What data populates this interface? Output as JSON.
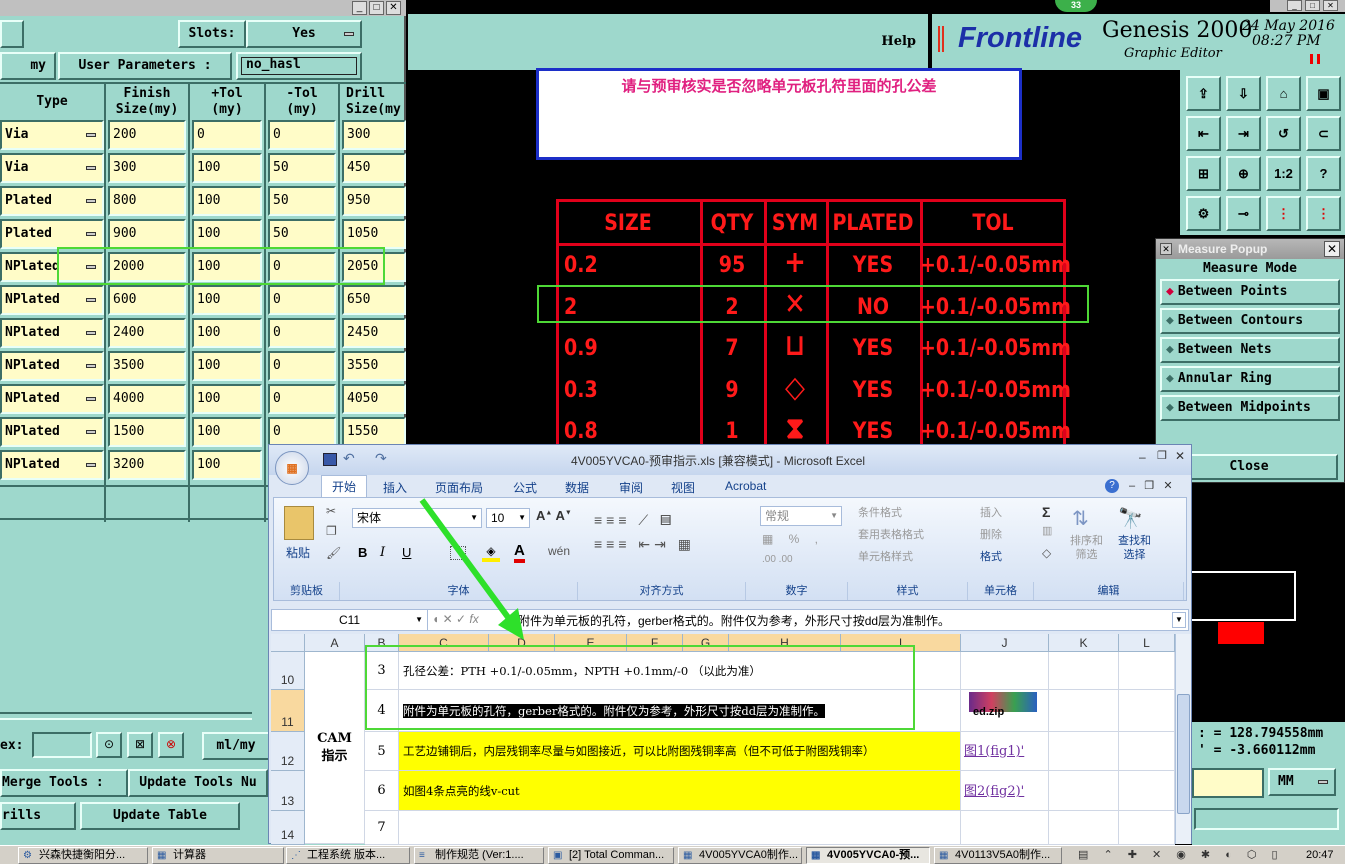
{
  "left_panel": {
    "slots_label": "Slots:",
    "slots_value": "Yes",
    "unit_label": "my",
    "user_params_label": "User Parameters :",
    "user_params_value": "no_hasl",
    "headers": [
      "Type",
      "Finish\nSize(my)",
      "+Tol\n(my)",
      "-Tol\n(my)",
      "Drill\nSize(my"
    ],
    "rows": [
      {
        "type": "Via",
        "finish": "200",
        "ptol": "0",
        "mtol": "0",
        "drill": "300"
      },
      {
        "type": "Via",
        "finish": "300",
        "ptol": "100",
        "mtol": "50",
        "drill": "450"
      },
      {
        "type": "Plated",
        "finish": "800",
        "ptol": "100",
        "mtol": "50",
        "drill": "950"
      },
      {
        "type": "Plated",
        "finish": "900",
        "ptol": "100",
        "mtol": "50",
        "drill": "1050"
      },
      {
        "type": "NPlated",
        "finish": "2000",
        "ptol": "100",
        "mtol": "0",
        "drill": "2050"
      },
      {
        "type": "NPlated",
        "finish": "600",
        "ptol": "100",
        "mtol": "0",
        "drill": "650"
      },
      {
        "type": "NPlated",
        "finish": "2400",
        "ptol": "100",
        "mtol": "0",
        "drill": "2450"
      },
      {
        "type": "NPlated",
        "finish": "3500",
        "ptol": "100",
        "mtol": "0",
        "drill": "3550"
      },
      {
        "type": "NPlated",
        "finish": "4000",
        "ptol": "100",
        "mtol": "0",
        "drill": "4050"
      },
      {
        "type": "NPlated",
        "finish": "1500",
        "ptol": "100",
        "mtol": "0",
        "drill": "1550"
      },
      {
        "type": "NPlated",
        "finish": "3200",
        "ptol": "100",
        "mtol": "",
        "drill": ""
      }
    ],
    "ex_label": "ex:",
    "units_btn": "ml/my",
    "merge_tools": "Merge Tools :",
    "update_tools": "Update Tools Nu",
    "drills": "rills",
    "update_table": "Update Table"
  },
  "genesis": {
    "help": "Help",
    "brand": "Frontline",
    "product": "Genesis 2000",
    "subtitle": "Graphic Editor",
    "date": "24 May 2016",
    "time": "08:27 PM",
    "badge": "33",
    "tool_icons": [
      "upload-icon",
      "download-icon",
      "home-icon",
      "window-icon",
      "move-left-icon",
      "move-right-icon",
      "undo-icon",
      "redo-icon",
      "fit-icon",
      "pan-icon",
      "scale-icon",
      "help-icon",
      "settings-icon",
      "measure-icon",
      "layer-icon",
      "layer-red-icon"
    ],
    "scale_text": "1:2",
    "note_text": "请与预审核实是否忽略单元板孔符里面的孔公差",
    "drill_table": {
      "headers": [
        "SIZE",
        "QTY",
        "SYM",
        "PLATED",
        "TOL"
      ],
      "rows": [
        {
          "size": "0.2",
          "qty": "95",
          "sym": "+",
          "plated": "YES",
          "tol": "+0.1/-0.05mm"
        },
        {
          "size": "2",
          "qty": "2",
          "sym": "✕",
          "plated": "NO",
          "tol": "+0.1/-0.05mm"
        },
        {
          "size": "0.9",
          "qty": "7",
          "sym": "⊔",
          "plated": "YES",
          "tol": "+0.1/-0.05mm"
        },
        {
          "size": "0.3",
          "qty": "9",
          "sym": "◇",
          "plated": "YES",
          "tol": "+0.1/-0.05mm"
        },
        {
          "size": "0.8",
          "qty": "1",
          "sym": "⧗",
          "plated": "YES",
          "tol": "+0.1/-0.05mm"
        }
      ]
    },
    "coord_x": "128.794558mm",
    "coord_y": "-3.660112mm",
    "unit_mm": "MM"
  },
  "measure_popup": {
    "title": "Measure Popup",
    "mode_label": "Measure Mode",
    "options": [
      "Between Points",
      "Between Contours",
      "Between Nets",
      "Annular Ring",
      "Between Midpoints"
    ],
    "selected": "Between Points",
    "close": "Close"
  },
  "excel": {
    "title": "4V005YVCA0-预审指示.xls  [兼容模式] - Microsoft Excel",
    "tabs": [
      "开始",
      "插入",
      "页面布局",
      "公式",
      "数据",
      "审阅",
      "视图",
      "Acrobat"
    ],
    "font_name": "宋体",
    "font_size": "10",
    "number_format": "常规",
    "groups": [
      "剪贴板",
      "字体",
      "对齐方式",
      "数字",
      "样式",
      "单元格",
      "编辑"
    ],
    "paste": "粘贴",
    "style_items": [
      "条件格式",
      "套用表格格式",
      "单元格样式"
    ],
    "cell_items": [
      "插入",
      "删除",
      "格式"
    ],
    "edit_items": [
      "排序和\n筛选",
      "查找和\n选择"
    ],
    "name_box": "C11",
    "formula": "附件为单元板的孔符，gerber格式的。附件仅为参考，外形尺寸按dd层为准制作。",
    "columns": [
      "A",
      "B",
      "C",
      "D",
      "E",
      "F",
      "G",
      "H",
      "I",
      "J",
      "K",
      "L"
    ],
    "row_numbers": [
      "10",
      "11",
      "12",
      "13",
      "14"
    ],
    "merged_label": "CAM\n指示",
    "rows": [
      {
        "no": "3",
        "text": "孔径公差：PTH +0.1/-0.05mm，NPTH +0.1mm/-0 （以此为准）",
        "link": ""
      },
      {
        "no": "4",
        "text": "附件为单元板的孔符，gerber格式的。附件仅为参考，外形尺寸按dd层为准制作。",
        "link": "ed.zip"
      },
      {
        "no": "5",
        "text": "工艺边铺铜后，内层残铜率尽量与如图接近，可以比附图残铜率高（但不可低于附图残铜率）",
        "link": "图1(fig1)'"
      },
      {
        "no": "6",
        "text": "如图4条点亮的线v-cut",
        "link": "图2(fig2)'"
      },
      {
        "no": "7",
        "text": "",
        "link": ""
      }
    ]
  },
  "taskbar": {
    "items": [
      "兴森快捷衡阳分...",
      "计算器",
      "工程系统  版本...",
      "制作规范 (Ver:1....",
      "[2] Total Comman...",
      "4V005YVCA0制作...",
      "4V005YVCA0-预...",
      "4V0113V5A0制作..."
    ],
    "clock": "20:47"
  }
}
